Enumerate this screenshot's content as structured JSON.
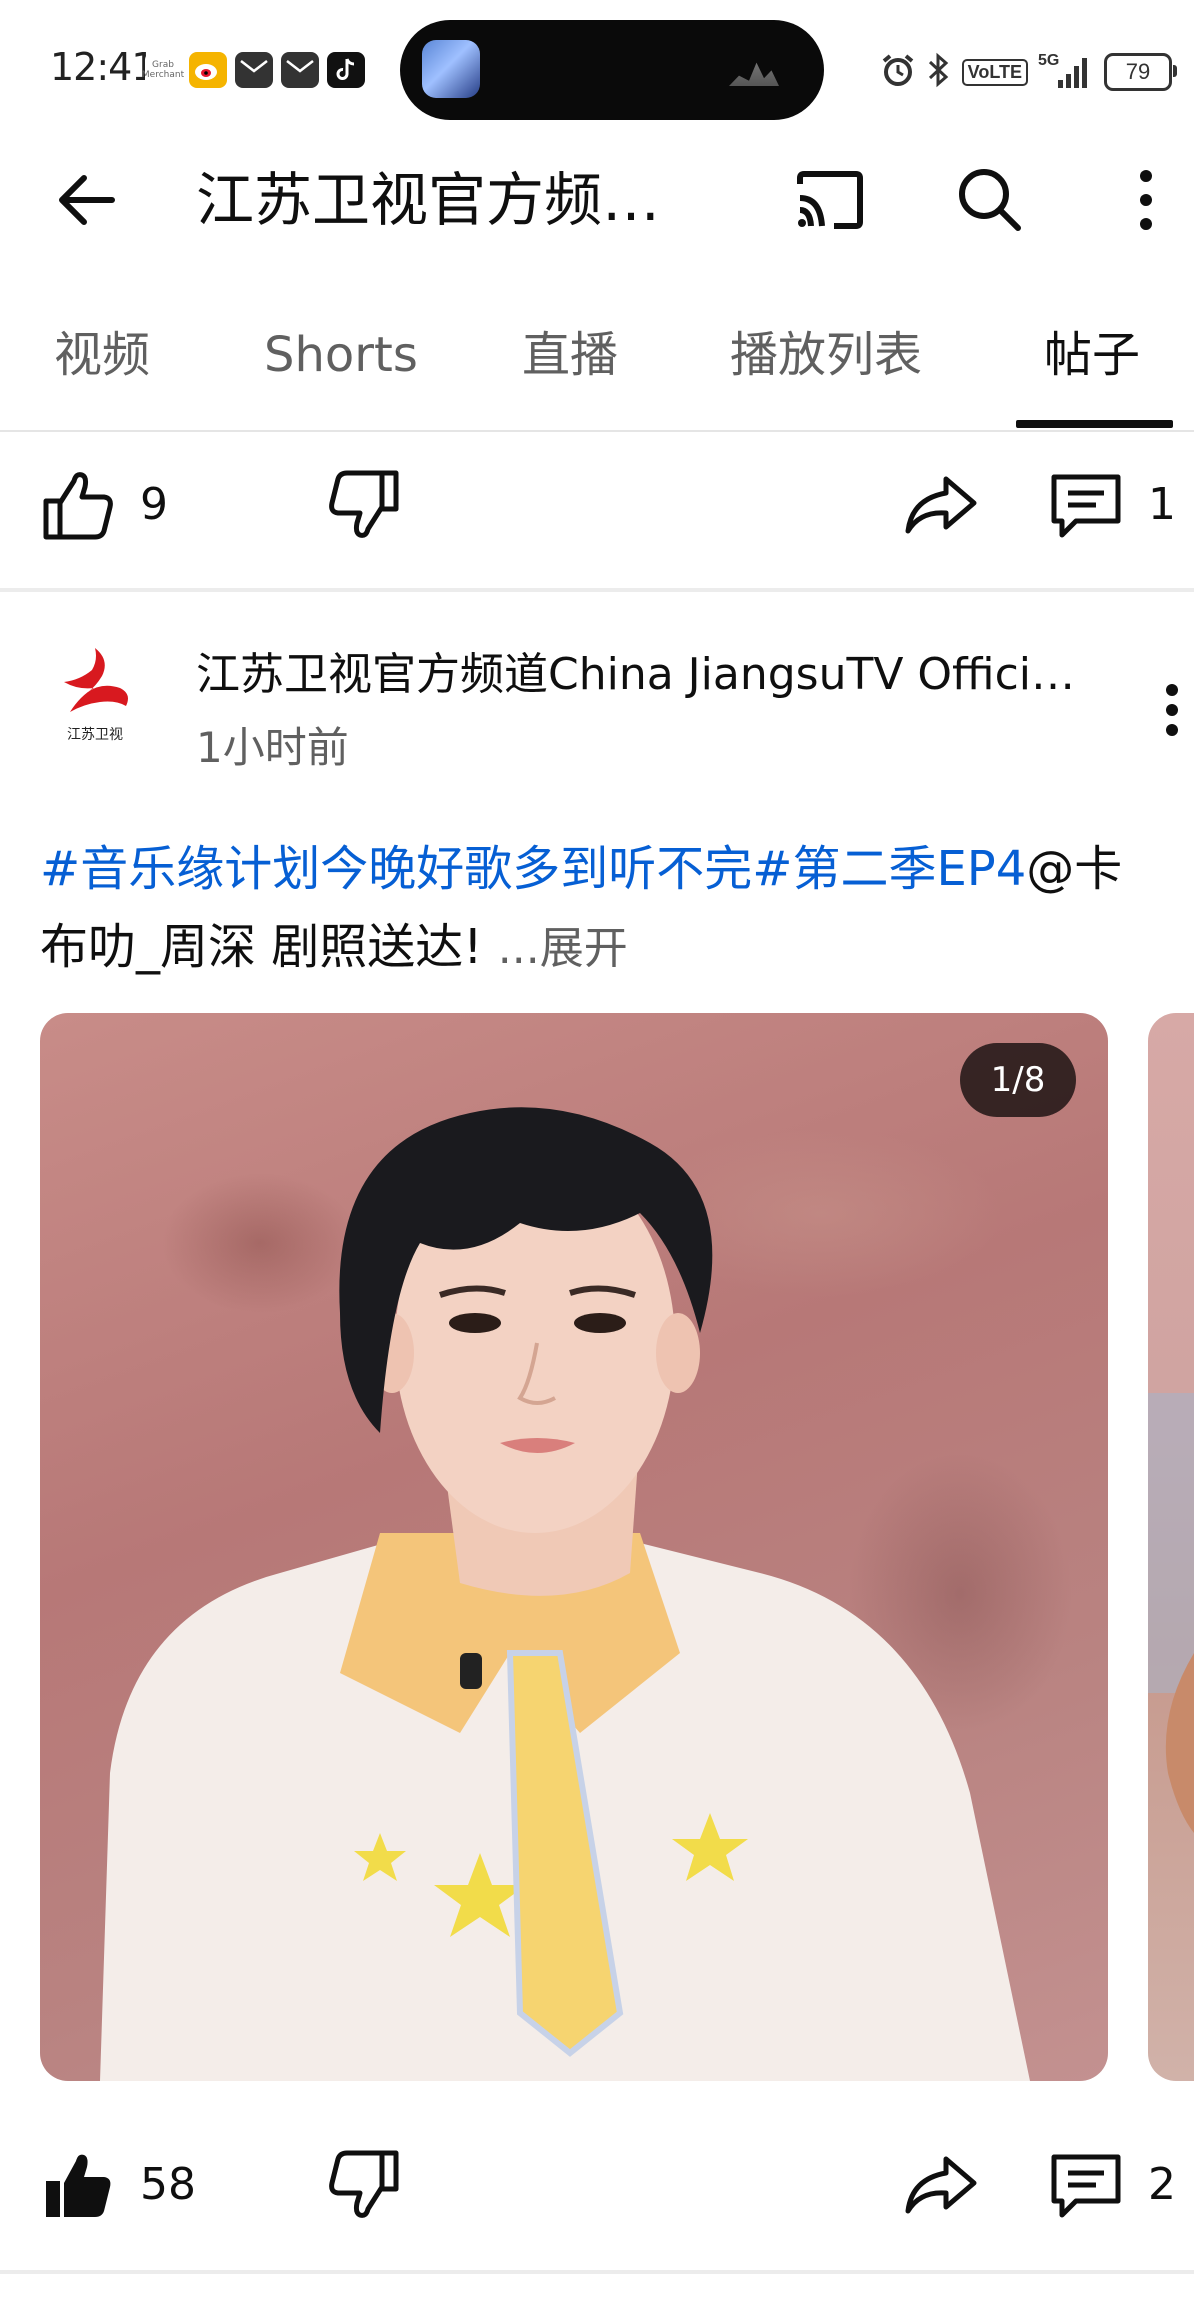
{
  "status_bar": {
    "time": "12:41",
    "notification_icons": [
      "grab-merchant-icon",
      "weibo-icon",
      "mail-icon",
      "mail-icon",
      "tiktok-icon"
    ],
    "network_label": "VoLTE",
    "signal_label": "5G",
    "battery_level": "79"
  },
  "app_bar": {
    "channel_title": "江苏卫视官方频…"
  },
  "tabs": [
    {
      "label": "视频",
      "active": false
    },
    {
      "label": "Shorts",
      "active": false
    },
    {
      "label": "直播",
      "active": false
    },
    {
      "label": "播放列表",
      "active": false
    },
    {
      "label": "帖子",
      "active": true
    }
  ],
  "previous_post_actions": {
    "like_count": "9",
    "comment_count": "1"
  },
  "post": {
    "avatar_label": "江苏卫视",
    "author": "江苏卫视官方频道China JiangsuTV Offici…",
    "time": "1小时前",
    "text_parts": {
      "hashtag_1": "#音乐缘计划今晚好歌多到听不完",
      "hashtag_2": "#第二季EP4",
      "mention": "@卡布叻_周深",
      "body": " 剧照送达!",
      "expand": "...展开"
    },
    "image_counter": "1/8",
    "like_count": "58",
    "comment_count": "2"
  },
  "colors": {
    "link_blue": "#065fd4",
    "text_primary": "#0f0f0f",
    "text_secondary": "#606060",
    "logo_red": "#d8191f"
  }
}
